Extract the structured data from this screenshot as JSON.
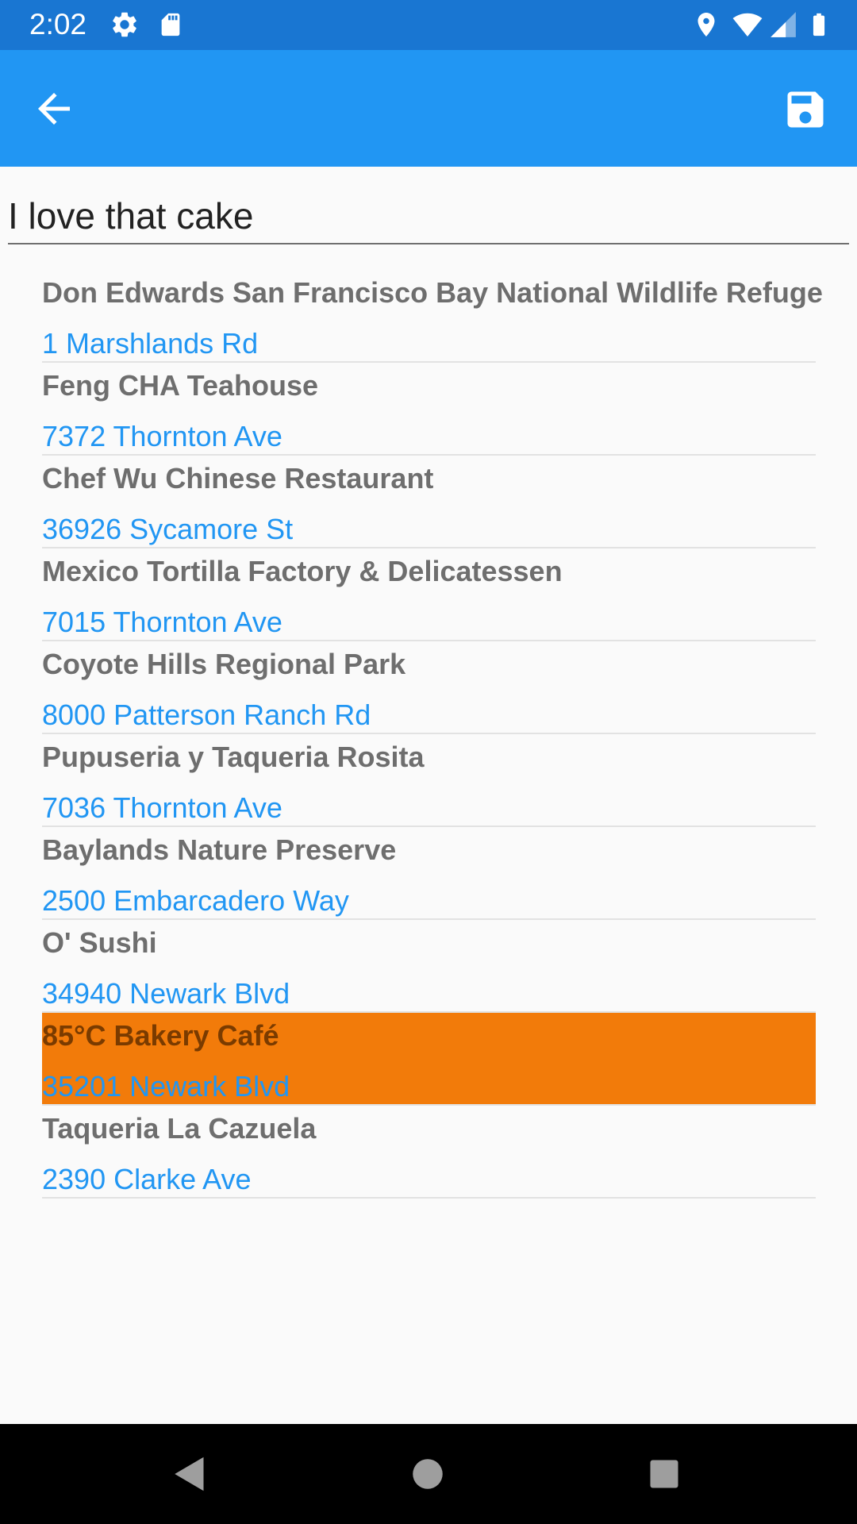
{
  "status_bar": {
    "time": "2:02",
    "icons": [
      "settings-icon",
      "sd-card-icon",
      "location-icon",
      "wifi-icon",
      "signal-icon",
      "battery-icon"
    ]
  },
  "app_bar": {
    "background": "#2196f3",
    "icons": [
      "back-arrow-icon",
      "save-icon"
    ]
  },
  "note": {
    "value": "I love that cake"
  },
  "places": [
    {
      "name": "Don Edwards San Francisco Bay National Wildlife Refuge",
      "address": "1 Marshlands Rd"
    },
    {
      "name": "Feng CHA Teahouse",
      "address": "7372 Thornton Ave"
    },
    {
      "name": "Chef Wu Chinese Restaurant",
      "address": "36926 Sycamore St"
    },
    {
      "name": "Mexico Tortilla Factory & Delicatessen",
      "address": "7015 Thornton Ave"
    },
    {
      "name": "Coyote Hills Regional Park",
      "address": "8000 Patterson Ranch Rd"
    },
    {
      "name": "Pupuseria y Taqueria Rosita",
      "address": "7036 Thornton Ave"
    },
    {
      "name": "Baylands Nature Preserve",
      "address": "2500 Embarcadero Way"
    },
    {
      "name": "O' Sushi",
      "address": "34940 Newark Blvd"
    },
    {
      "name": "85°C Bakery Café",
      "address": "35201 Newark Blvd",
      "selected": true
    },
    {
      "name": "Taqueria La Cazuela",
      "address": "2390 Clarke Ave"
    }
  ],
  "colors": {
    "status_bar": "#1976d2",
    "accent": "#2196f3",
    "selected_row": "#f27b0a",
    "place_name": "#6e6e6e"
  },
  "nav_bar": {
    "icons": [
      "back-triangle-icon",
      "home-circle-icon",
      "recents-square-icon"
    ]
  }
}
